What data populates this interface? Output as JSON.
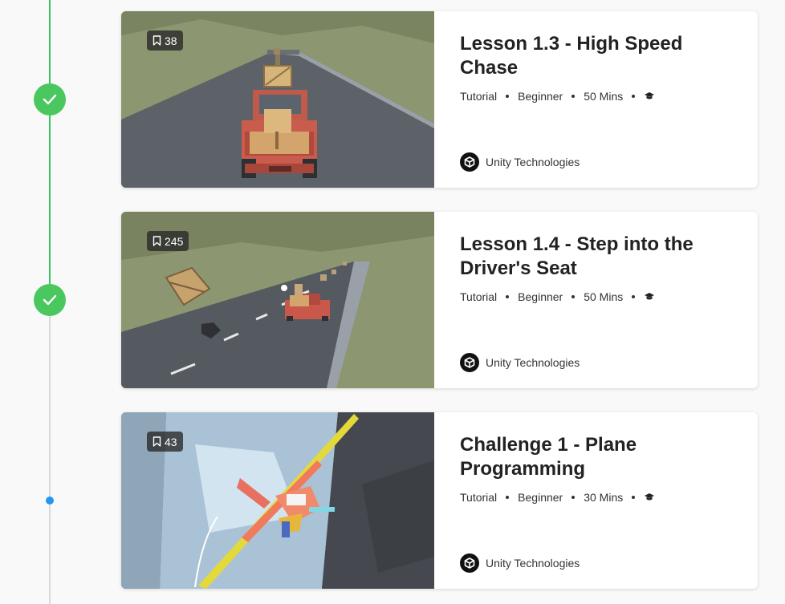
{
  "timeline": {
    "steps": [
      {
        "state": "completed",
        "icon": "check-icon"
      },
      {
        "state": "completed",
        "icon": "check-icon"
      },
      {
        "state": "current",
        "icon": "dot"
      }
    ],
    "colors": {
      "done": "#3cc25c",
      "current": "#2196f3",
      "pending": "#d9d9d9"
    }
  },
  "cards": [
    {
      "bookmarks": "38",
      "title": "Lesson 1.3 - High Speed Chase",
      "type": "Tutorial",
      "level": "Beginner",
      "duration": "50 Mins",
      "author": "Unity Technologies"
    },
    {
      "bookmarks": "245",
      "title": "Lesson 1.4 - Step into the Driver's Seat",
      "type": "Tutorial",
      "level": "Beginner",
      "duration": "50 Mins",
      "author": "Unity Technologies"
    },
    {
      "bookmarks": "43",
      "title": "Challenge 1 - Plane Programming",
      "type": "Tutorial",
      "level": "Beginner",
      "duration": "30 Mins",
      "author": "Unity Technologies"
    }
  ]
}
